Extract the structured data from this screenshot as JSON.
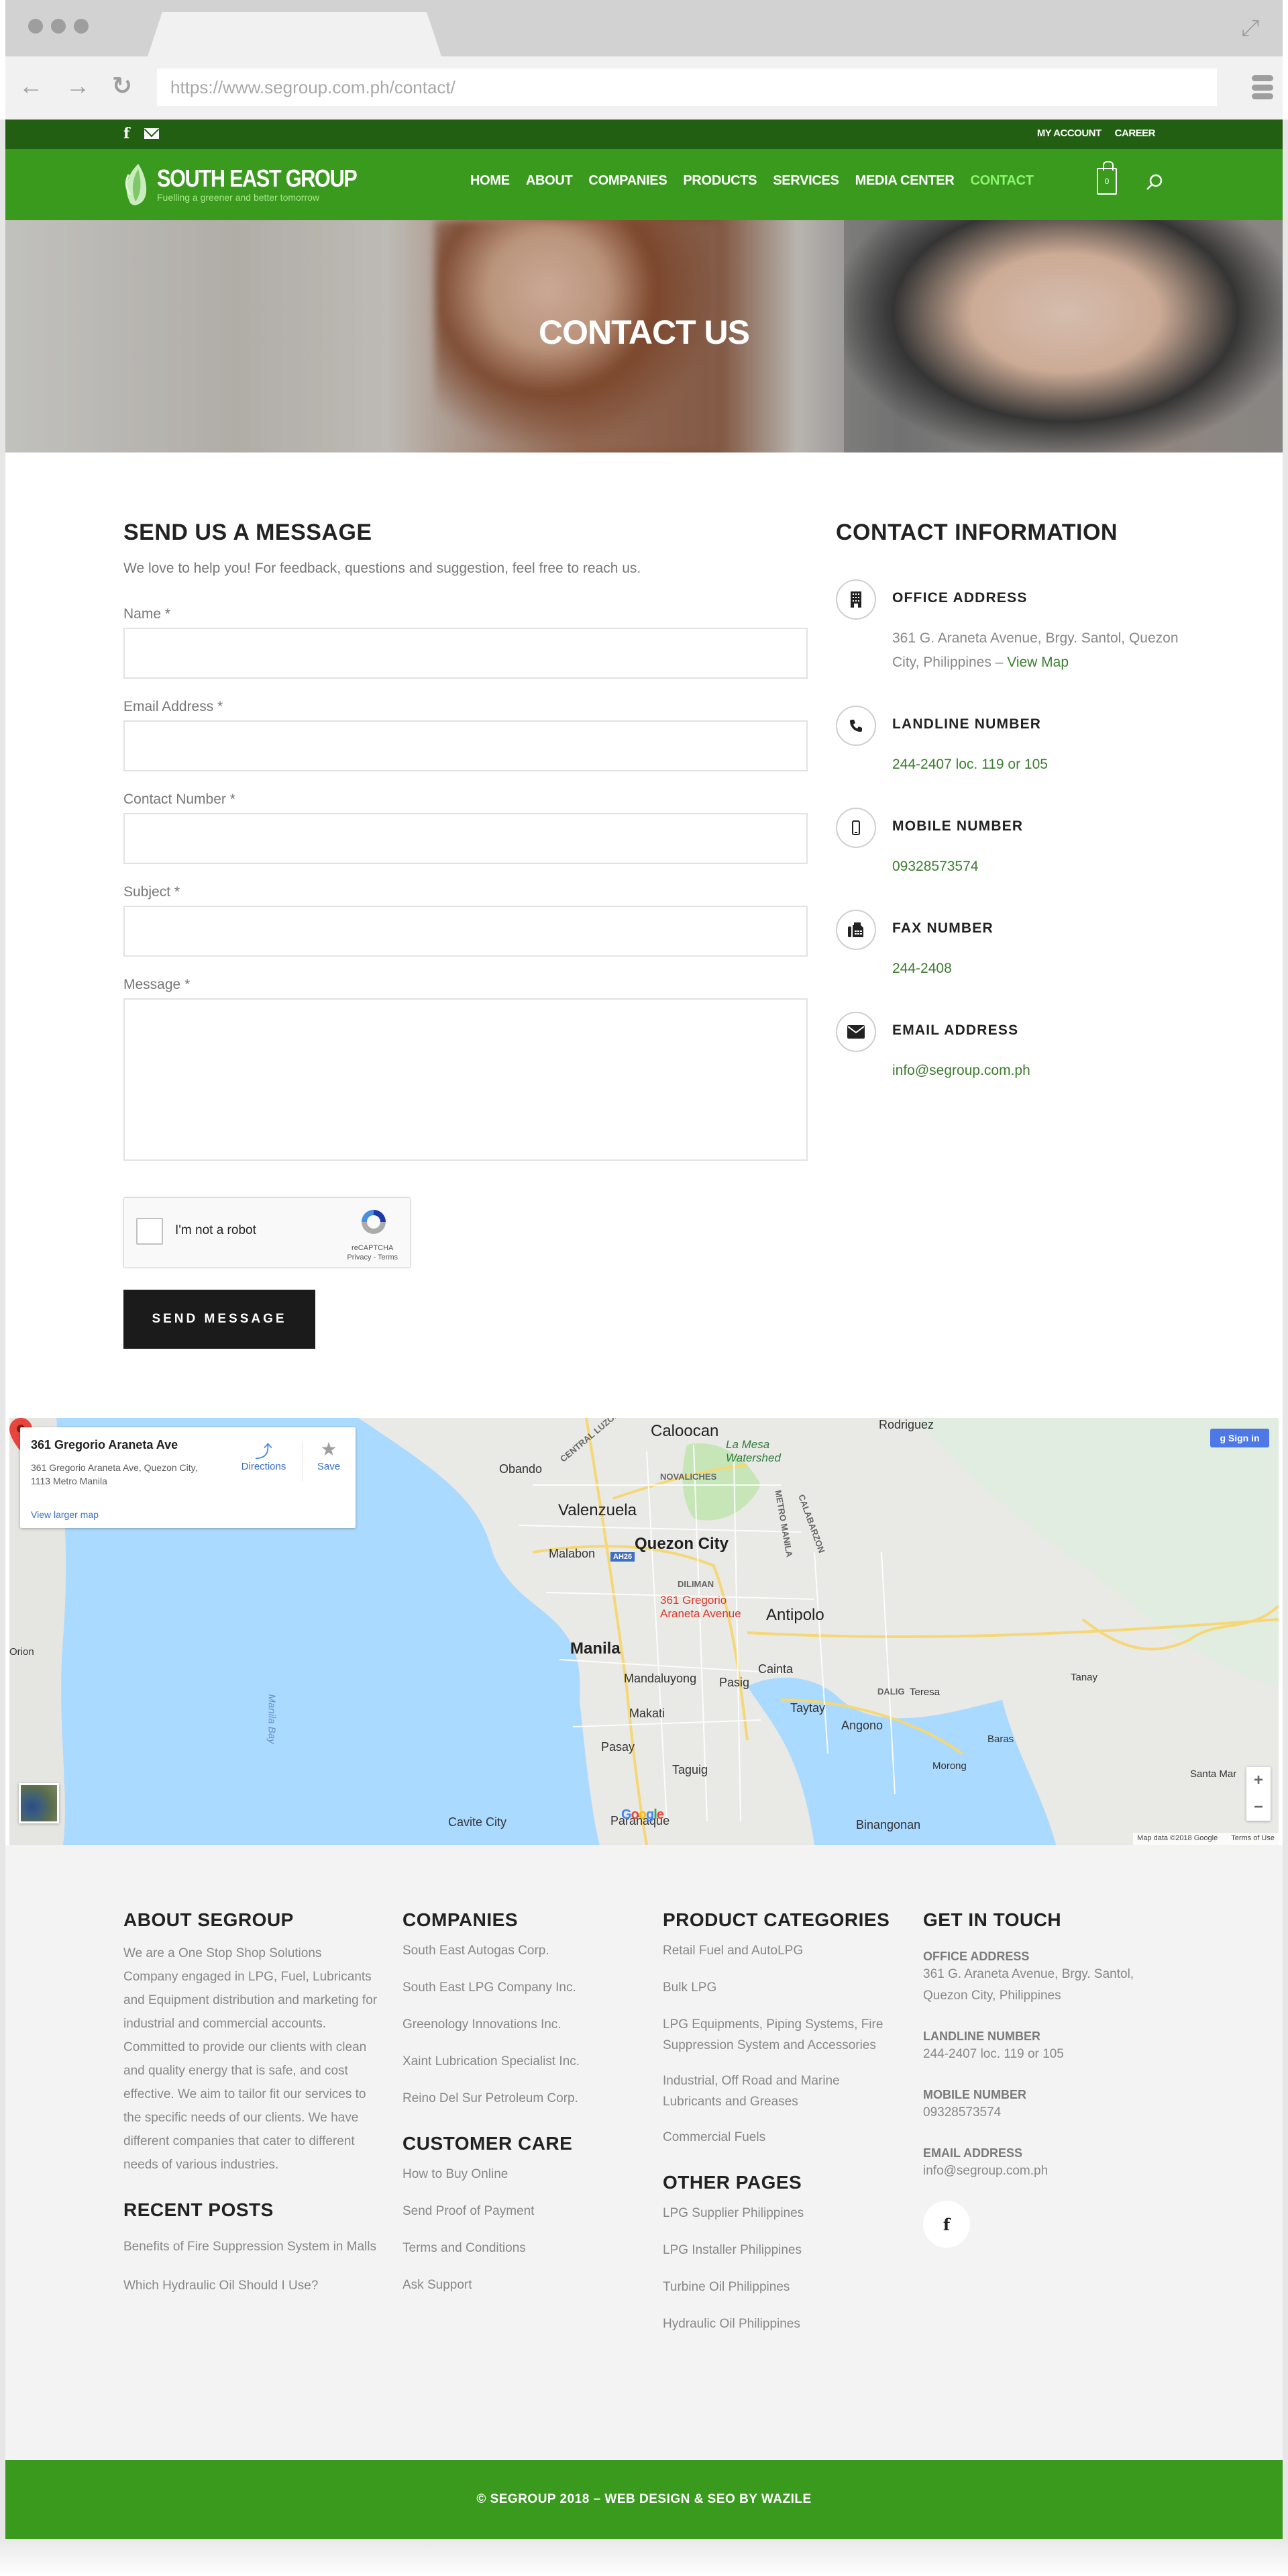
{
  "browser": {
    "url": "https://www.segroup.com.ph/contact/"
  },
  "topbar": {
    "social_icons": [
      "facebook-icon",
      "email-icon"
    ],
    "links": [
      "MY ACCOUNT",
      "CAREER"
    ]
  },
  "header": {
    "logo_title": "SOUTH EAST GROUP",
    "logo_tagline": "Fuelling a greener and better tomorrow",
    "nav": [
      "HOME",
      "ABOUT",
      "COMPANIES",
      "PRODUCTS",
      "SERVICES",
      "MEDIA CENTER",
      "CONTACT"
    ],
    "active_nav": "CONTACT",
    "cart_count": "0"
  },
  "hero": {
    "title": "CONTACT US"
  },
  "form": {
    "title": "SEND US A MESSAGE",
    "intro": "We love to help you! For feedback, questions and suggestion, feel free to reach us.",
    "fields": [
      {
        "label": "Name *",
        "value": ""
      },
      {
        "label": "Email Address *",
        "value": ""
      },
      {
        "label": "Contact Number *",
        "value": ""
      },
      {
        "label": "Subject *",
        "value": ""
      },
      {
        "label": "Message *",
        "value": ""
      }
    ],
    "captcha_label": "I'm not a robot",
    "captcha_brand": "reCAPTCHA",
    "captcha_links": "Privacy - Terms",
    "submit_label": "SEND MESSAGE"
  },
  "contact_info": {
    "title": "CONTACT INFORMATION",
    "items": [
      {
        "icon": "building-icon",
        "heading": "OFFICE ADDRESS",
        "text": "361 G. Araneta Avenue, Brgy. Santol, Quezon City, Philippines – ",
        "link": "View Map"
      },
      {
        "icon": "phone-icon",
        "heading": "LANDLINE NUMBER",
        "text": "244-2407 loc. 119 or 105"
      },
      {
        "icon": "mobile-icon",
        "heading": "MOBILE NUMBER",
        "text": "09328573574"
      },
      {
        "icon": "fax-icon",
        "heading": "FAX NUMBER",
        "text": "244-2408"
      },
      {
        "icon": "envelope-icon",
        "heading": "EMAIL ADDRESS",
        "text": "info@segroup.com.ph"
      }
    ]
  },
  "map": {
    "card_title": "361 Gregorio Araneta Ave",
    "card_address": "361 Gregorio Araneta Ave, Quezon City, 1113 Metro Manila",
    "card_link": "View larger map",
    "directions_label": "Directions",
    "save_label": "Save",
    "signin_label": "Sign in",
    "pin_label": "361 Gregorio Araneta Avenue",
    "places": [
      "Caloocan",
      "Rodriguez",
      "Obando",
      "Valenzuela",
      "Quezon City",
      "Malabon",
      "Manila",
      "Antipolo",
      "Mandaluyong",
      "Pasig",
      "Cainta",
      "Makati",
      "Taytay",
      "Pasay",
      "Angono",
      "Teresa",
      "Taguig",
      "Tanay",
      "Baras",
      "Morong",
      "Santa Mar",
      "Cavite City",
      "Parañaque",
      "Binangonan",
      "Orion"
    ],
    "districts": [
      "NOVALICHES",
      "DILIMAN",
      "METRO MANILA",
      "CENTRAL LUZON",
      "CALABARZON",
      "DALIG"
    ],
    "park_label": "La Mesa Watershed",
    "water_label": "Manila Bay",
    "road_shield": "AH26",
    "attribution": "Map data ©2018 Google",
    "terms": "Terms of Use",
    "zoom_in": "+",
    "zoom_out": "−"
  },
  "footer": {
    "about": {
      "title": "ABOUT SEGROUP",
      "text": "We are a One Stop Shop Solutions Company engaged in LPG, Fuel, Lubricants and Equipment distribution and marketing for industrial and commercial accounts. Committed to provide our clients with clean and quality energy that is safe, and cost effective. We aim to tailor fit our services to the specific needs of our clients. We have different companies that cater to different needs of various industries."
    },
    "recent_posts": {
      "title": "RECENT POSTS",
      "items": [
        "Benefits of Fire Suppression System in Malls",
        "Which Hydraulic Oil Should I Use?"
      ]
    },
    "companies": {
      "title": "COMPANIES",
      "items": [
        "South East Autogas Corp.",
        "South East LPG Company Inc.",
        "Greenology Innovations Inc.",
        "Xaint Lubrication Specialist Inc.",
        "Reino Del Sur Petroleum Corp."
      ]
    },
    "customer_care": {
      "title": "CUSTOMER CARE",
      "items": [
        "How to Buy Online",
        "Send Proof of Payment",
        "Terms and Conditions",
        "Ask Support"
      ]
    },
    "product_categories": {
      "title": "PRODUCT CATEGORIES",
      "items": [
        "Retail Fuel and AutoLPG",
        "Bulk LPG",
        "LPG Equipments, Piping Systems, Fire Suppression System and Accessories",
        "Industrial, Off Road and Marine Lubricants and Greases",
        "Commercial Fuels"
      ]
    },
    "other_pages": {
      "title": "OTHER PAGES",
      "items": [
        "LPG Supplier Philippines",
        "LPG Installer Philippines",
        "Turbine Oil Philippines",
        "Hydraulic Oil Philippines"
      ]
    },
    "get_in_touch": {
      "title": "GET IN TOUCH",
      "entries": [
        {
          "label": "OFFICE ADDRESS",
          "value": "361 G. Araneta Avenue, Brgy. Santol, Quezon City, Philippines"
        },
        {
          "label": "LANDLINE NUMBER",
          "value": "244-2407 loc. 119 or 105"
        },
        {
          "label": "MOBILE NUMBER",
          "value": "09328573574"
        },
        {
          "label": "EMAIL ADDRESS",
          "value": "info@segroup.com.ph"
        }
      ],
      "social": "facebook-icon"
    },
    "copyright": "© SEGROUP 2018 – WEB DESIGN & SEO BY WAZILE"
  },
  "colors": {
    "brand_green": "#3a9a1e",
    "topbar_green": "#225f13",
    "nav_active": "#8ef56b",
    "link_green": "#3c7d2f",
    "button_dark": "#1b1b1b"
  }
}
